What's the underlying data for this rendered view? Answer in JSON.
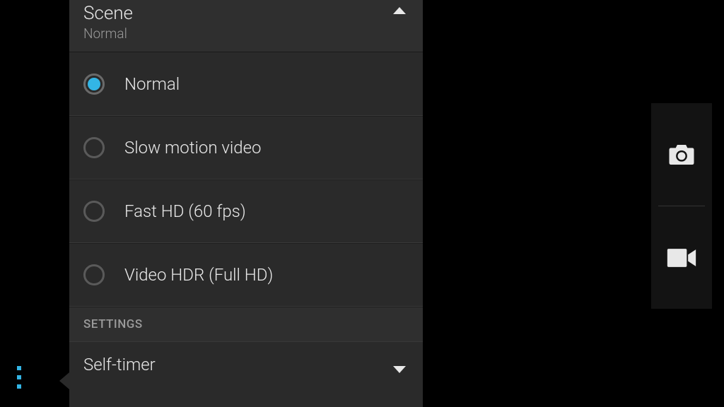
{
  "scene": {
    "title": "Scene",
    "subtitle": "Normal",
    "options": [
      {
        "label": "Normal",
        "selected": true
      },
      {
        "label": "Slow motion video",
        "selected": false
      },
      {
        "label": "Fast HD (60 fps)",
        "selected": false
      },
      {
        "label": "Video HDR (Full HD)",
        "selected": false
      }
    ]
  },
  "settings": {
    "header": "SETTINGS",
    "items": [
      {
        "label": "Self-timer"
      }
    ]
  },
  "toolbar": {
    "camera": "camera",
    "video": "video"
  },
  "colors": {
    "accent": "#33b5e5",
    "panel": "#2a2a2a",
    "text": "#e8e8e8",
    "muted": "#9a9a9a"
  }
}
